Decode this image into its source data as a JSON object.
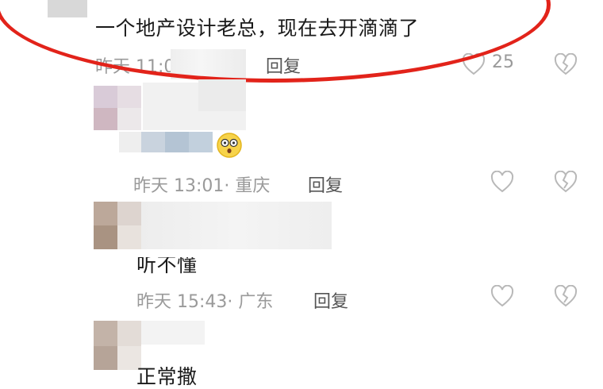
{
  "comments": [
    {
      "text": "一个地产设计老总，现在去开滴滴了",
      "meta": "昨天 11:0",
      "reply_label": "回复",
      "like_count": "25",
      "icons": [
        "heart-icon",
        "broken-heart-icon"
      ]
    },
    {
      "text": "",
      "meta": "昨天 13:01· 重庆",
      "reply_label": "回复",
      "icons": [
        "heart-icon",
        "broken-heart-icon"
      ]
    },
    {
      "text": "听不懂",
      "meta": "昨天 15:43· 广东",
      "reply_label": "回复",
      "icons": [
        "heart-icon",
        "broken-heart-icon"
      ]
    },
    {
      "text": "正常撒"
    }
  ],
  "highlight": {
    "color": "#e2231a"
  }
}
